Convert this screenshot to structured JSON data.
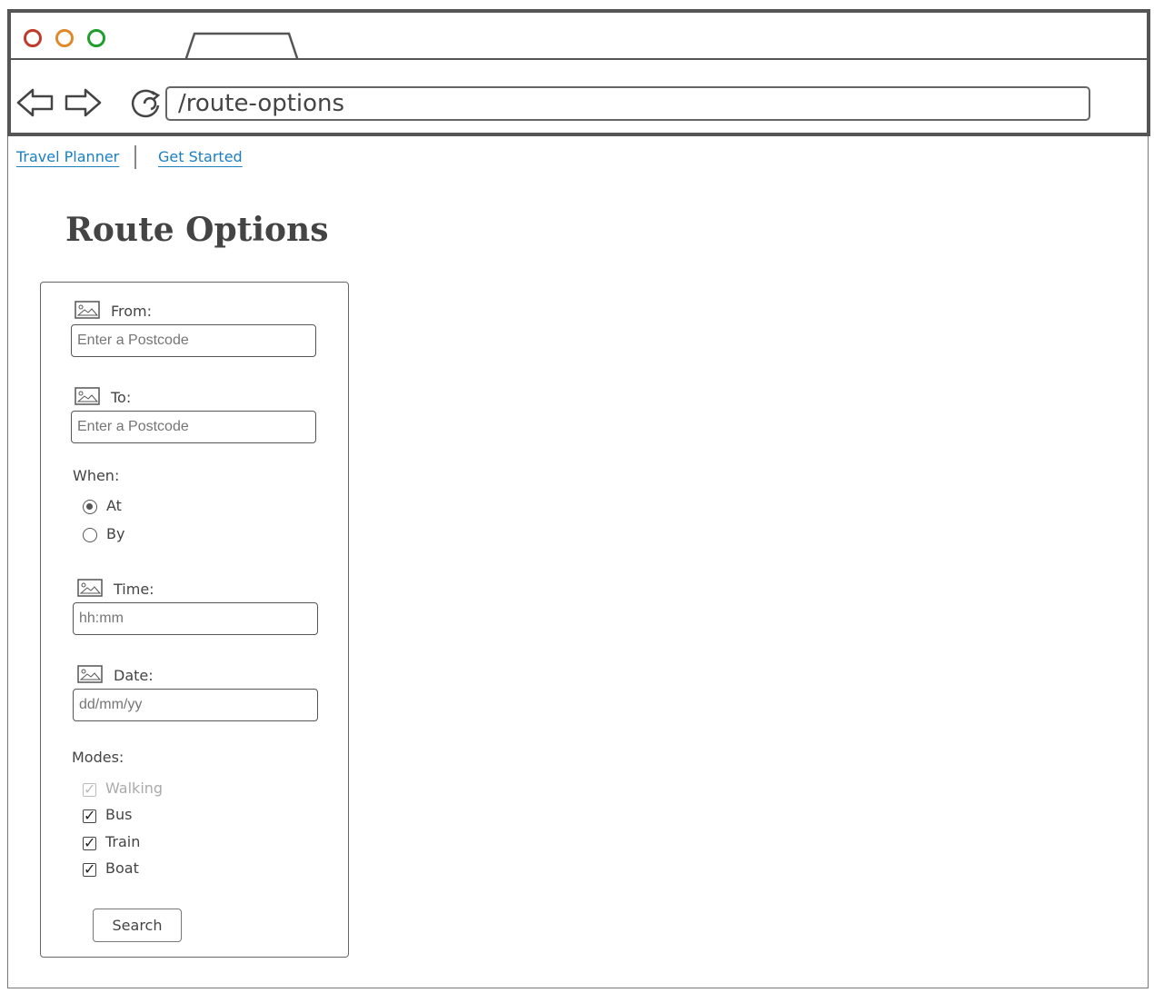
{
  "browser": {
    "url": "/route-options",
    "colors": {
      "close": "#c0392b",
      "minimize": "#e0892a",
      "maximize": "#1f9e2b"
    }
  },
  "breadcrumb": {
    "items": [
      {
        "label": "Travel Planner"
      },
      {
        "label": "Get Started"
      }
    ]
  },
  "page": {
    "title": "Route Options"
  },
  "form": {
    "from": {
      "label": "From:",
      "placeholder": "Enter a Postcode"
    },
    "to": {
      "label": "To:",
      "placeholder": "Enter a Postcode"
    },
    "when": {
      "label": "When:",
      "options": [
        {
          "label": "At",
          "selected": true
        },
        {
          "label": "By",
          "selected": false
        }
      ]
    },
    "time": {
      "label": "Time:",
      "placeholder": "hh:mm"
    },
    "date": {
      "label": "Date:",
      "placeholder": "dd/mm/yy"
    },
    "modes": {
      "label": "Modes:",
      "options": [
        {
          "label": "Walking",
          "checked": true,
          "disabled": true
        },
        {
          "label": "Bus",
          "checked": true,
          "disabled": false
        },
        {
          "label": "Train",
          "checked": true,
          "disabled": false
        },
        {
          "label": "Boat",
          "checked": true,
          "disabled": false
        }
      ]
    },
    "search_label": "Search"
  }
}
